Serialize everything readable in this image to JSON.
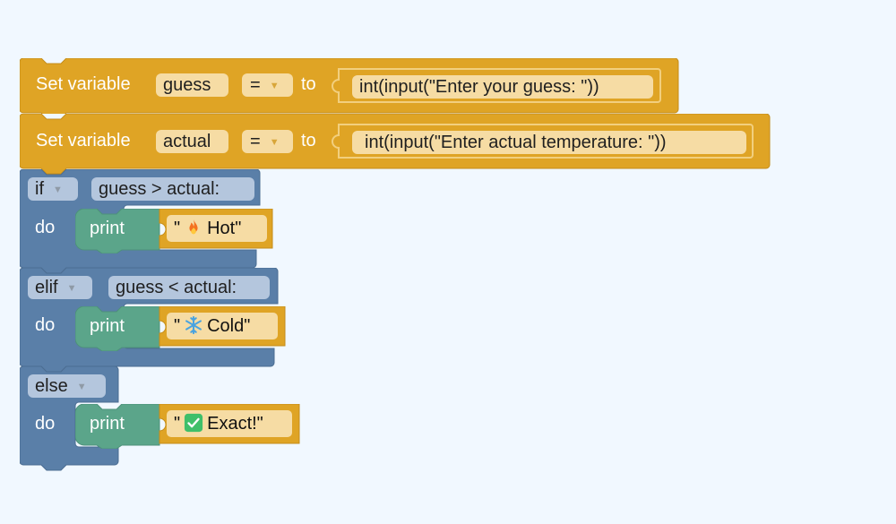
{
  "colors": {
    "variables": "#dfa425",
    "variables_edge": "#c48d1b",
    "control": "#5a7fa8",
    "control_edge": "#4b6d92",
    "print": "#5ba58a",
    "field_gold": "#f6dca4",
    "field_blue": "#b4c6dd",
    "workspace": "#f1f8ff"
  },
  "blocks": {
    "set_guess": {
      "prefix": "Set variable",
      "var_name": "guess",
      "operator": "=",
      "connector": "to",
      "expression": "int(input(\"Enter your guess: \"))"
    },
    "set_actual": {
      "prefix": "Set variable",
      "var_name": "actual",
      "operator": "=",
      "connector": "to",
      "expression": "int(input(\"Enter actual temperature: \"))"
    },
    "if_branch": {
      "keyword": "if",
      "condition": "guess > actual:",
      "do_label": "do",
      "print_label": "print",
      "quote": "\"",
      "icon": "fire-icon",
      "message": "Hot\""
    },
    "elif_branch": {
      "keyword": "elif",
      "condition": "guess < actual:",
      "do_label": "do",
      "print_label": "print",
      "quote": "\"",
      "icon": "snowflake-icon",
      "message": "Cold\""
    },
    "else_branch": {
      "keyword": "else",
      "do_label": "do",
      "print_label": "print",
      "quote": "\"",
      "icon": "check-box-icon",
      "message": "Exact!\""
    }
  }
}
